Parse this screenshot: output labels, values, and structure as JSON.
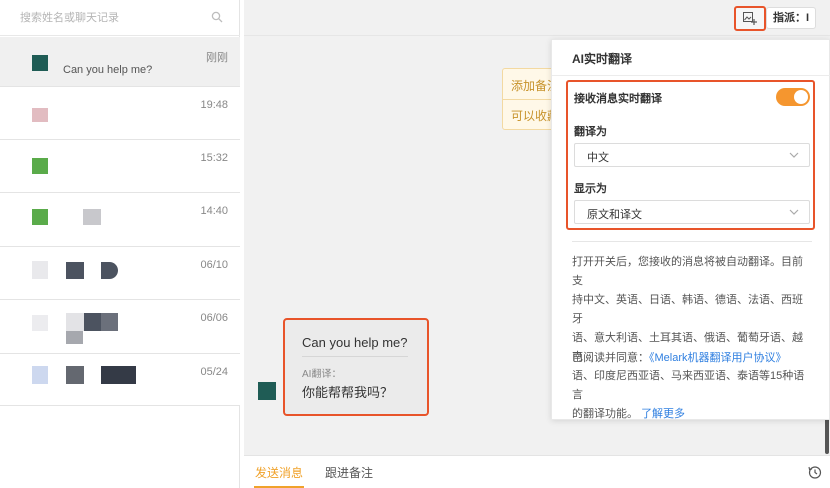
{
  "search": {
    "placeholder": "搜索姓名或聊天记录"
  },
  "conversations": [
    {
      "time": "刚刚",
      "preview": "Can you help me?",
      "active": true
    },
    {
      "time": "19:48",
      "preview": ""
    },
    {
      "time": "15:32",
      "preview": ""
    },
    {
      "time": "14:40",
      "preview": ""
    },
    {
      "time": "06/10",
      "preview": ""
    },
    {
      "time": "06/06",
      "preview": ""
    },
    {
      "time": "05/24",
      "preview": ""
    }
  ],
  "header": {
    "assign_label": "指派：I",
    "translate_icon": "translate-image-icon"
  },
  "note_card": {
    "line1": "添加备注",
    "line2": "可以收藏"
  },
  "message": {
    "original": "Can you help me?",
    "ai_label": "AI翻译：",
    "translated": "你能帮帮我吗？"
  },
  "footer": {
    "tabs": [
      {
        "label": "发送消息",
        "active": true
      },
      {
        "label": "跟进备注",
        "active": false
      }
    ]
  },
  "panel": {
    "title": "AI实时翻译",
    "receive_label": "接收消息实时翻译",
    "receive_on": true,
    "translate_to_label": "翻译为",
    "translate_to_value": "中文",
    "display_as_label": "显示为",
    "display_as_value": "原文和译文",
    "desc_lines": [
      "打开开关后，您接收的消息将被自动翻译。目前支",
      "持中文、英语、日语、韩语、德语、法语、西班牙",
      "语、意大利语、土耳其语、俄语、葡萄牙语、越南",
      "语、印度尼西亚语、马来西亚语、泰语等15种语言",
      "的翻译功能。"
    ],
    "learn_more": "了解更多",
    "agree_prefix": "已阅读并同意：",
    "agree_link": "《Melark机器翻译用户协议》"
  },
  "colors": {
    "accent_orange": "#f5962f",
    "highlight_red": "#e8542a",
    "link_blue": "#2f7fe0",
    "tab_active": "#f0a22a"
  }
}
